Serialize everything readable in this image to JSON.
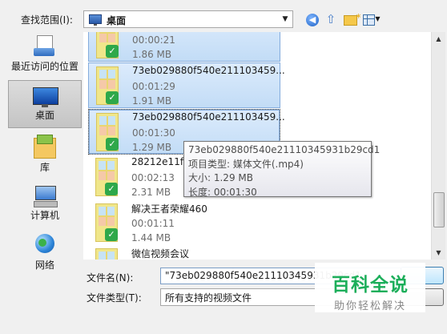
{
  "toolbar": {
    "look_in_label": "查找范围(I):",
    "look_in_value": "桌面",
    "icons": [
      "back-icon",
      "up-folder-icon",
      "new-folder-icon",
      "view-menu-icon"
    ]
  },
  "places": [
    {
      "label": "最近访问的位置",
      "icon": "recent-places-icon",
      "selected": false
    },
    {
      "label": "桌面",
      "icon": "desktop-icon",
      "selected": true
    },
    {
      "label": "库",
      "icon": "libraries-icon",
      "selected": false
    },
    {
      "label": "计算机",
      "icon": "computer-icon",
      "selected": false
    },
    {
      "label": "网络",
      "icon": "network-icon",
      "selected": false
    }
  ],
  "files": [
    {
      "name": "",
      "duration": "00:00:21",
      "size": "1.86 MB",
      "selected": true
    },
    {
      "name": "73eb029880f540e211103459...",
      "duration": "00:01:29",
      "size": "1.91 MB",
      "selected": true
    },
    {
      "name": "73eb029880f540e211103459...",
      "duration": "00:01:30",
      "size": "1.29 MB",
      "selected": true,
      "focused": true
    },
    {
      "name": "28212e11f1",
      "duration": "00:02:13",
      "size": "2.31 MB",
      "selected": false
    },
    {
      "name": "解决王者荣耀460",
      "duration": "00:01:11",
      "size": "1.44 MB",
      "selected": false
    },
    {
      "name": "微信视频会议",
      "duration": "",
      "size": "",
      "selected": false
    }
  ],
  "tooltip": {
    "line1": "73eb029880f540e21110345931b29cd1",
    "line2": "项目类型: 媒体文件(.mp4)",
    "line3": "大小: 1.29 MB",
    "line4": "长度: 00:01:30"
  },
  "bottom": {
    "filename_label": "文件名(N):",
    "filename_value": "\"73eb029880f540e21110345931b29cd1",
    "filetype_label": "文件类型(T):",
    "filetype_value": "所有支持的视频文件"
  },
  "watermark": {
    "title": "百科全说",
    "subtitle": "助你轻松解决"
  },
  "colors": {
    "selection": "#cce4f7",
    "watermark_green": "#1cae5a"
  }
}
